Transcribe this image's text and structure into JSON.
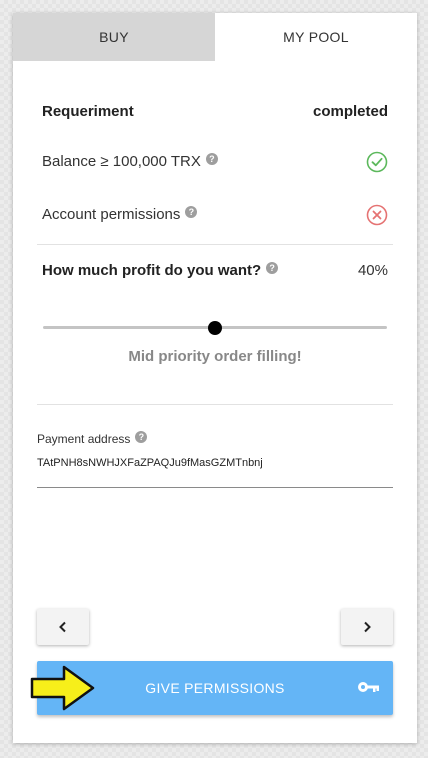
{
  "tabs": [
    {
      "label": "BUY",
      "active": false
    },
    {
      "label": "MY POOL",
      "active": true
    }
  ],
  "requirements": {
    "header_label": "Requeriment",
    "header_status": "completed",
    "items": [
      {
        "label": "Balance ≥ 100,000 TRX",
        "status": "check-icon",
        "color": "#5cb85c"
      },
      {
        "label": "Account permissions",
        "status": "cross-icon",
        "color": "#e57373"
      }
    ]
  },
  "profit": {
    "label": "How much profit do you want?",
    "value": "40%",
    "slider_fraction": 0.5,
    "priority_text": "Mid priority order filling!"
  },
  "payment": {
    "label": "Payment address",
    "address": "TAtPNH8sNWHJXFaZPAQJu9fMasGZMTnbnj"
  },
  "nav": {
    "prev_icon": "chevron-left-icon",
    "next_icon": "chevron-right-icon"
  },
  "give_button": {
    "label": "GIVE PERMISSIONS",
    "icon": "key-icon",
    "color": "#64b5f6"
  },
  "help_glyph": "?",
  "annotation": {
    "icon": "yellow-arrow-icon",
    "color": "#f7ef1a"
  }
}
